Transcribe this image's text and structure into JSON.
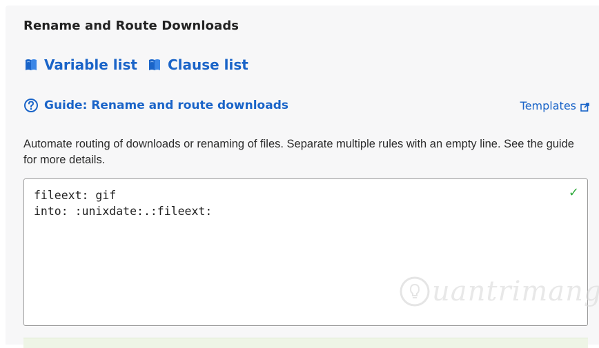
{
  "section": {
    "title": "Rename and Route Downloads"
  },
  "links": {
    "variable_list": "Variable list",
    "clause_list": "Clause list",
    "icon": "book-icon",
    "color": "#1a64c8"
  },
  "guide": {
    "label": "Guide: Rename and route downloads",
    "icon": "help-circle-icon"
  },
  "templates": {
    "label": "Templates",
    "icon": "external-link-icon"
  },
  "description": "Automate routing of downloads or renaming of files. Separate multiple rules with an empty line. See the guide for more details.",
  "rules_editor": {
    "lines": [
      "fileext: gif",
      "into: :unixdate:.:fileext:"
    ],
    "status_icon": "check-icon",
    "status_color": "#2eaa3c"
  },
  "watermark": {
    "text": "uantrimang"
  }
}
